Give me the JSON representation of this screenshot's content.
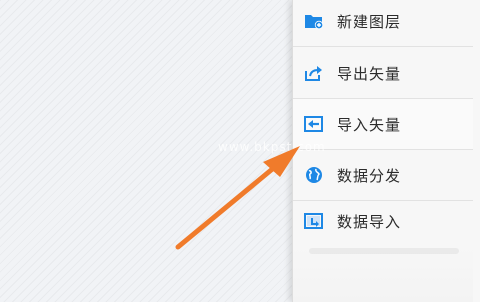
{
  "menu": {
    "items": [
      {
        "label": "新建图层",
        "icon": "new-layer-icon"
      },
      {
        "label": "导出矢量",
        "icon": "export-vector-icon"
      },
      {
        "label": "导入矢量",
        "icon": "import-vector-icon"
      },
      {
        "label": "数据分发",
        "icon": "globe-distribute-icon"
      },
      {
        "label": "数据导入",
        "icon": "data-import-icon"
      }
    ]
  },
  "watermark": "www.bkpst.com",
  "colors": {
    "accent": "#1e88e5",
    "arrow": "#f07b2b"
  }
}
